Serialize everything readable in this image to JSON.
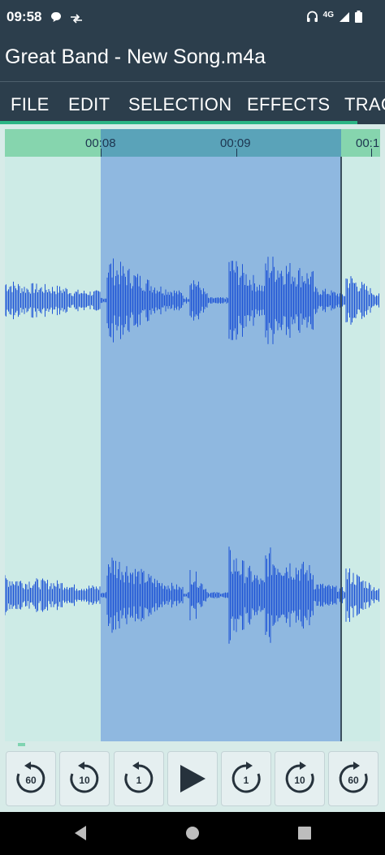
{
  "status_bar": {
    "time": "09:58",
    "network_label": "4G",
    "icons": [
      "chat-bubble-icon",
      "data-transfer-icon",
      "headphones-icon",
      "signal-icon",
      "battery-icon"
    ]
  },
  "app": {
    "title": "Great Band - New Song.m4a"
  },
  "menu": {
    "items": [
      {
        "label": "FILE"
      },
      {
        "label": "EDIT"
      },
      {
        "label": "SELECTION"
      },
      {
        "label": "EFFECTS"
      },
      {
        "label": "TRAC"
      }
    ]
  },
  "timeline": {
    "ticks": [
      "00:08",
      "00:09",
      "00:1"
    ]
  },
  "controls": {
    "buttons": [
      {
        "label": "60",
        "icon": "rewind-icon"
      },
      {
        "label": "10",
        "icon": "rewind-icon"
      },
      {
        "label": "1",
        "icon": "rewind-icon"
      },
      {
        "label": "",
        "icon": "play-icon"
      },
      {
        "label": "1",
        "icon": "forward-icon"
      },
      {
        "label": "10",
        "icon": "forward-icon"
      },
      {
        "label": "60",
        "icon": "forward-icon"
      }
    ]
  },
  "colors": {
    "header_bg": "#2c3e4c",
    "accent": "#2bb585",
    "waveform": "#1f55d6",
    "selection": "#8fb8e0",
    "track_bg": "#cdebe6"
  }
}
